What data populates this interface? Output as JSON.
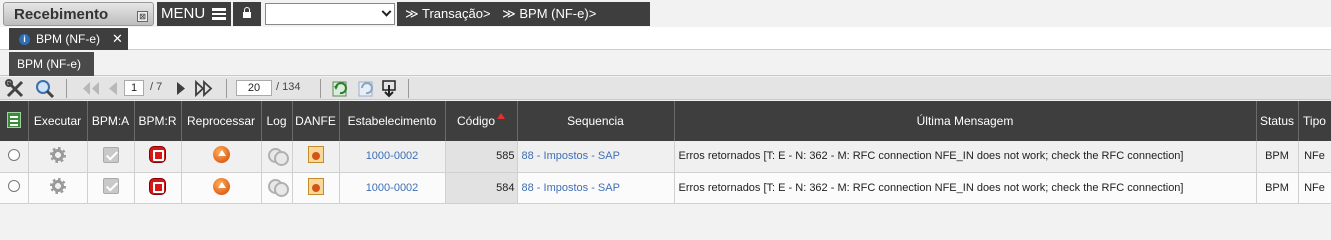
{
  "app": {
    "title": "Recebimento",
    "pin_glyph": "⊠",
    "menu_label": "MENU"
  },
  "breadcrumbs": [
    "≫ Transação>",
    "≫ BPM (NF-e)>"
  ],
  "top_select": {
    "value": ""
  },
  "tabs": [
    {
      "label": "BPM (NF-e)",
      "info_glyph": "i",
      "close_glyph": "✕"
    }
  ],
  "page_label": "BPM (NF-e)",
  "pager": {
    "current_page": "1",
    "total_pages": "/ 7",
    "page_size": "20",
    "total_records": "/ 134"
  },
  "grid": {
    "columns": [
      "Executar",
      "BPM:A",
      "BPM:R",
      "Reprocessar",
      "Log",
      "DANFE",
      "Estabelecimento",
      "Código",
      "Sequencia",
      "Última Mensagem",
      "Status",
      "Tipo"
    ],
    "rows": [
      {
        "estabelecimento": "1000-0002",
        "codigo": "585",
        "sequencia": "88 - Impostos - SAP",
        "mensagem": "Erros retornados [T: E - N: 362 - M: RFC connection NFE_IN does not work; check the RFC connection]",
        "status": "BPM",
        "tipo": "NFe"
      },
      {
        "estabelecimento": "1000-0002",
        "codigo": "584",
        "sequencia": "88 - Impostos - SAP",
        "mensagem": "Erros retornados [T: E - N: 362 - M: RFC connection NFE_IN does not work; check the RFC connection]",
        "status": "BPM",
        "tipo": "NFe"
      }
    ]
  },
  "colors": {
    "header_bg": "#3e3e3e",
    "link": "#3f6fb5",
    "stop_red": "#d21818",
    "sort_arrow": "#e53030"
  }
}
